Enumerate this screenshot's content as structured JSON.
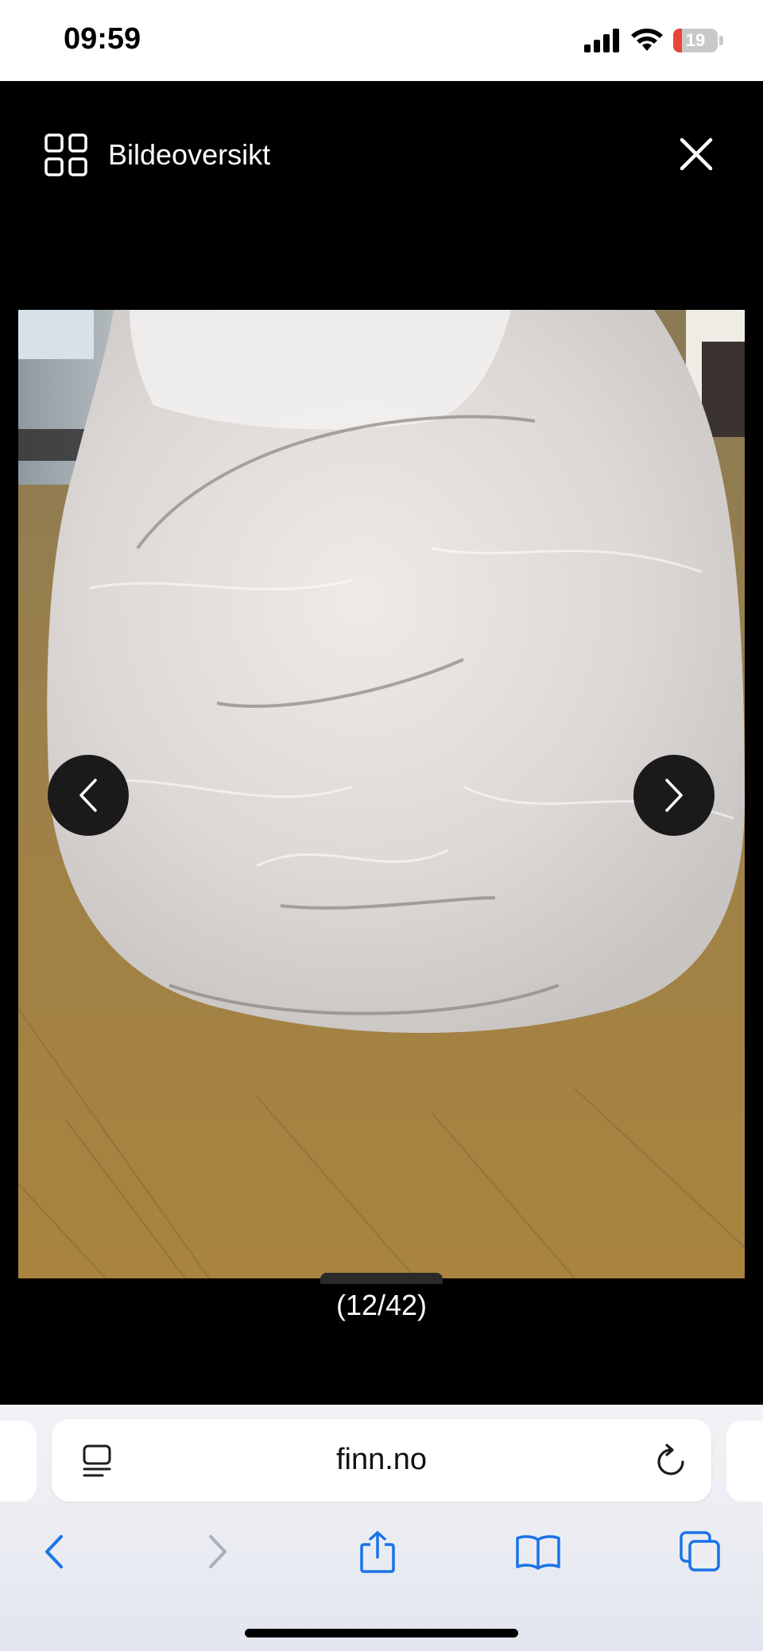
{
  "status_bar": {
    "time": "09:59",
    "battery_level": "19",
    "battery_fraction": 0.19
  },
  "header": {
    "overview_label": "Bildeoversikt",
    "overview_icon": "grid-icon",
    "close_icon": "close-icon"
  },
  "gallery": {
    "counter": "(12/42)",
    "prev_icon": "chevron-left-icon",
    "next_icon": "chevron-right-icon"
  },
  "browser": {
    "url": "finn.no",
    "reader_icon": "page-menu-icon",
    "reload_icon": "reload-icon",
    "toolbar_icons": [
      "back-icon",
      "forward-icon",
      "share-icon",
      "bookmarks-icon",
      "tabs-icon"
    ],
    "accent_color": "#1a73e8"
  }
}
